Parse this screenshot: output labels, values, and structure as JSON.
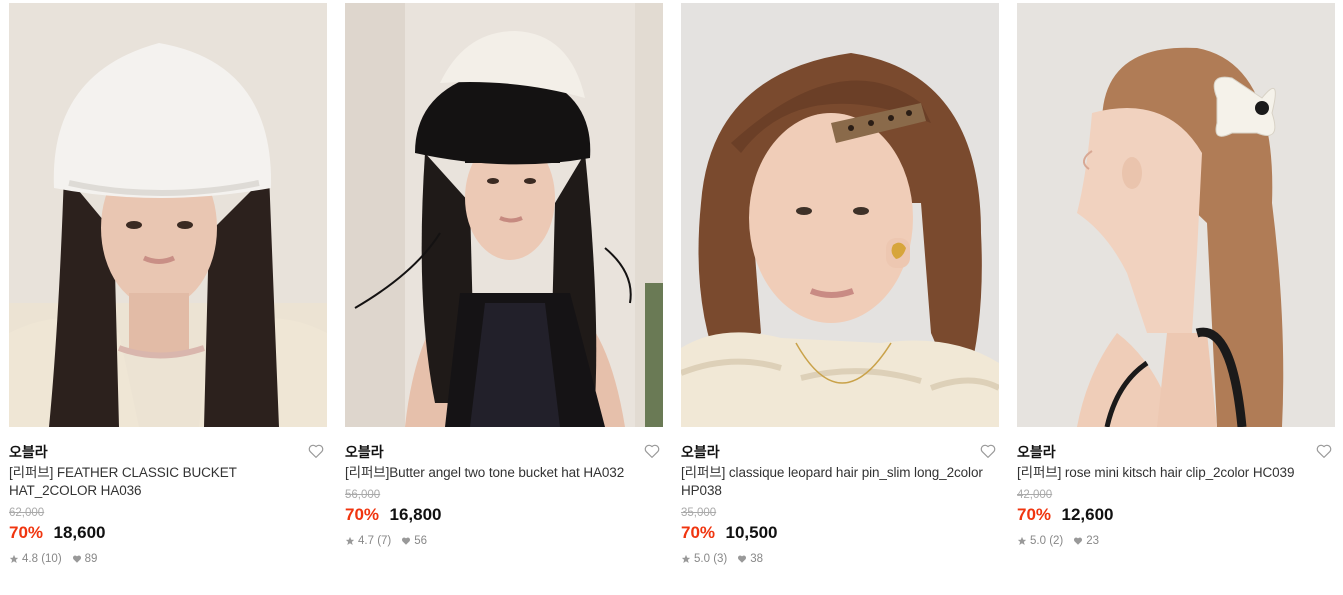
{
  "products": [
    {
      "brand": "오블라",
      "title": "[리퍼브] FEATHER CLASSIC BUCKET HAT_2COLOR HA036",
      "original_price": "62,000",
      "discount": "70%",
      "price": "18,600",
      "rating": "4.8",
      "reviews": "(10)",
      "likes": "89"
    },
    {
      "brand": "오블라",
      "title": "[리퍼브]Butter angel two tone bucket hat HA032",
      "original_price": "56,000",
      "discount": "70%",
      "price": "16,800",
      "rating": "4.7",
      "reviews": "(7)",
      "likes": "56"
    },
    {
      "brand": "오블라",
      "title": "[리퍼브] classique leopard hair pin_slim long_2color HP038",
      "original_price": "35,000",
      "discount": "70%",
      "price": "10,500",
      "rating": "5.0",
      "reviews": "(3)",
      "likes": "38"
    },
    {
      "brand": "오블라",
      "title": "[리퍼브] rose mini kitsch hair clip_2color HC039",
      "original_price": "42,000",
      "discount": "70%",
      "price": "12,600",
      "rating": "5.0",
      "reviews": "(2)",
      "likes": "23"
    }
  ],
  "colors": {
    "discount": "#f0350f",
    "price": "#111111",
    "muted": "#888888",
    "strike": "#aaaaaa"
  },
  "icons": {
    "wishlist": "heart-outline-icon",
    "rating": "star-icon",
    "likes": "heart-filled-icon"
  }
}
